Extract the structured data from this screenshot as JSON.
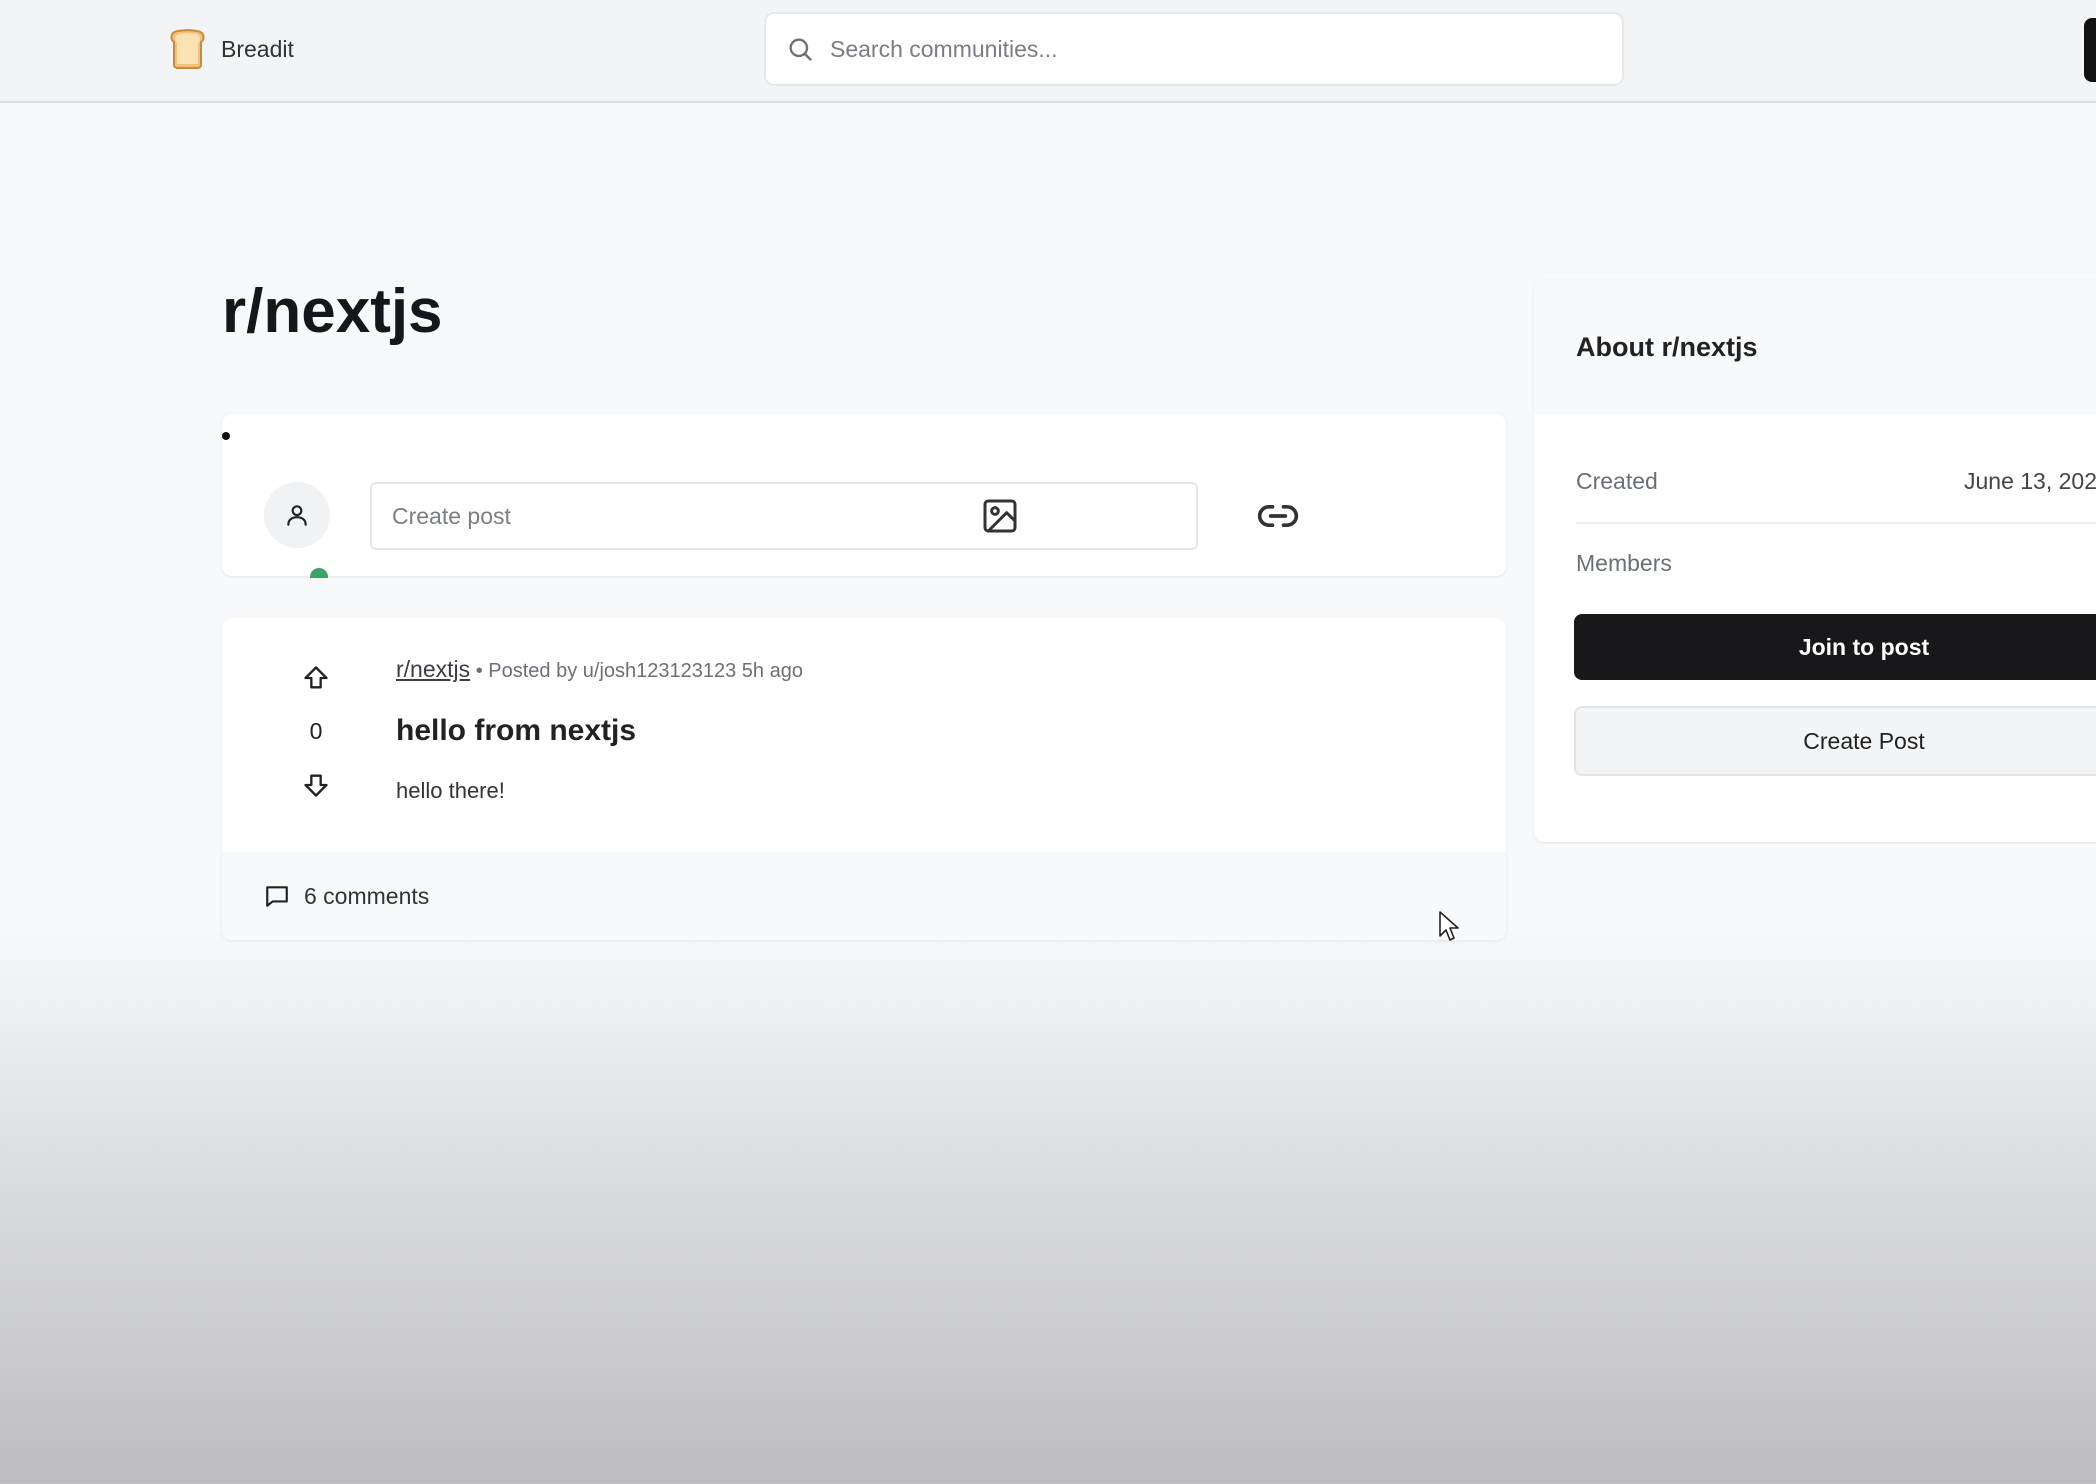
{
  "header": {
    "brand_name": "Breadit",
    "search_placeholder": "Search communities..."
  },
  "community": {
    "title": "r/nextjs"
  },
  "create_post": {
    "placeholder": "Create post"
  },
  "post": {
    "subreddit": "r/nextjs",
    "meta": "• Posted by u/josh123123123 5h ago",
    "title": "hello from nextjs",
    "body": "hello there!",
    "votes": "0",
    "comments": "6 comments"
  },
  "sidebar": {
    "title": "About r/nextjs",
    "created_label": "Created",
    "created_value": "June 13, 202",
    "members_label": "Members",
    "join_label": "Join to post",
    "create_post_label": "Create Post"
  },
  "colors": {
    "primary_button": "#18181a",
    "online_status": "#3aa56a"
  }
}
